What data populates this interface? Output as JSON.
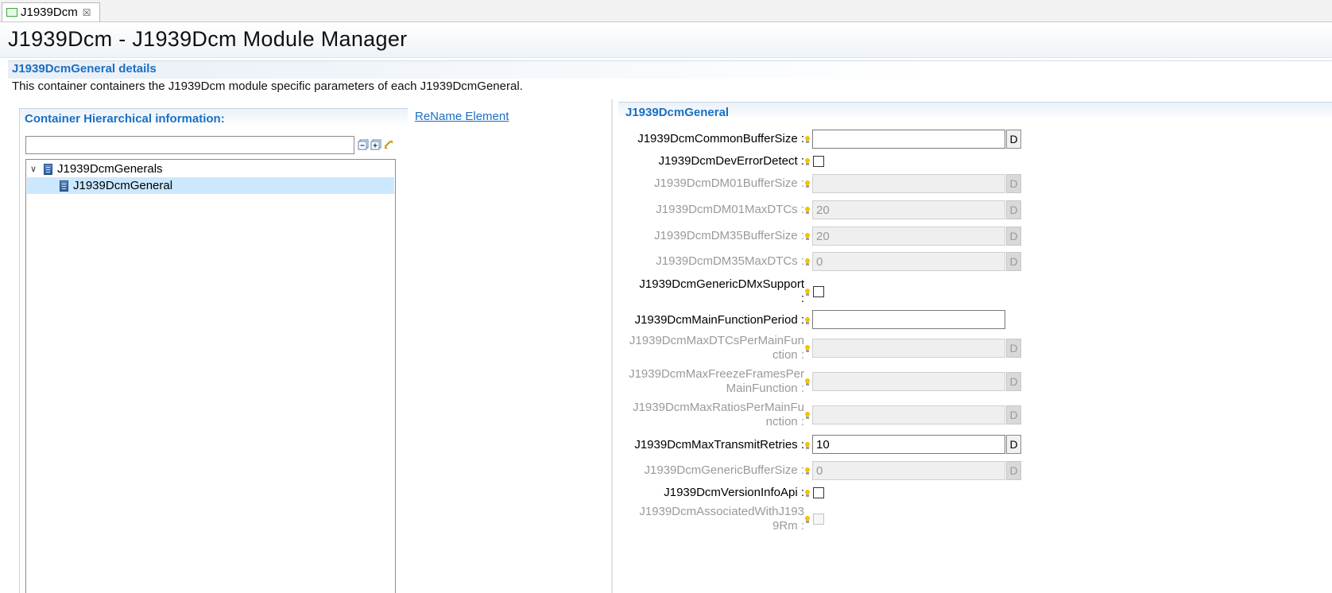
{
  "tab": {
    "label": "J1939Dcm",
    "close_glyph": "☒"
  },
  "header": {
    "title": "J1939Dcm - J1939Dcm Module Manager"
  },
  "section": {
    "title": "J1939DcmGeneral details",
    "description": "This container containers the J1939Dcm module specific parameters of each J1939DcmGeneral."
  },
  "left_panel": {
    "title": "Container Hierarchical information:",
    "filter_value": "",
    "tree": [
      {
        "label": "J1939DcmGenerals",
        "expanded": true,
        "selected": false,
        "twisty": "∨"
      },
      {
        "label": "J1939DcmGeneral",
        "selected": true
      }
    ],
    "toolbar_icons": [
      "collapse-all-icon",
      "expand-all-icon",
      "link-sync-icon"
    ]
  },
  "rename_link": "ReName Element",
  "right_panel": {
    "title": "J1939DcmGeneral",
    "params": [
      {
        "label": "J1939DcmCommonBufferSize :",
        "type": "text",
        "value": "",
        "enabled": true,
        "button": "D"
      },
      {
        "label": "J1939DcmDevErrorDetect :",
        "type": "checkbox",
        "checked": false,
        "enabled": true
      },
      {
        "label": "J1939DcmDM01BufferSize :",
        "type": "text",
        "value": "",
        "enabled": false,
        "button": "D"
      },
      {
        "label": "J1939DcmDM01MaxDTCs :",
        "type": "text",
        "value": "20",
        "enabled": false,
        "button": "D"
      },
      {
        "label": "J1939DcmDM35BufferSize :",
        "type": "text",
        "value": "20",
        "enabled": false,
        "button": "D"
      },
      {
        "label": "J1939DcmDM35MaxDTCs :",
        "type": "text",
        "value": "0",
        "enabled": false,
        "button": "D"
      },
      {
        "label_lines": [
          "J1939DcmGenericDMxSupport",
          ":"
        ],
        "type": "checkbox",
        "checked": false,
        "enabled": true
      },
      {
        "label": "J1939DcmMainFunctionPeriod :",
        "type": "text",
        "value": "",
        "enabled": true
      },
      {
        "label_lines": [
          "J1939DcmMaxDTCsPerMainFun",
          "ction :"
        ],
        "type": "text",
        "value": "",
        "enabled": false,
        "button": "D"
      },
      {
        "label_lines": [
          "J1939DcmMaxFreezeFramesPer",
          "MainFunction :"
        ],
        "type": "text",
        "value": "",
        "enabled": false,
        "button": "D"
      },
      {
        "label_lines": [
          "J1939DcmMaxRatiosPerMainFu",
          "nction :"
        ],
        "type": "text",
        "value": "",
        "enabled": false,
        "button": "D"
      },
      {
        "label": "J1939DcmMaxTransmitRetries :",
        "type": "text",
        "value": "10",
        "enabled": true,
        "button": "D"
      },
      {
        "label": "J1939DcmGenericBufferSize :",
        "type": "text",
        "value": "0",
        "enabled": false,
        "button": "D"
      },
      {
        "label": "J1939DcmVersionInfoApi :",
        "type": "checkbox",
        "checked": false,
        "enabled": true
      },
      {
        "label_lines": [
          "J1939DcmAssociatedWithJ193",
          "9Rm :"
        ],
        "type": "checkbox",
        "checked": false,
        "enabled": false
      }
    ]
  },
  "colors": {
    "accent": "#1a6fc4",
    "selection": "#cce8ff",
    "disabled_text": "#9a9a9a",
    "hint_bulb": "#f2c300"
  }
}
